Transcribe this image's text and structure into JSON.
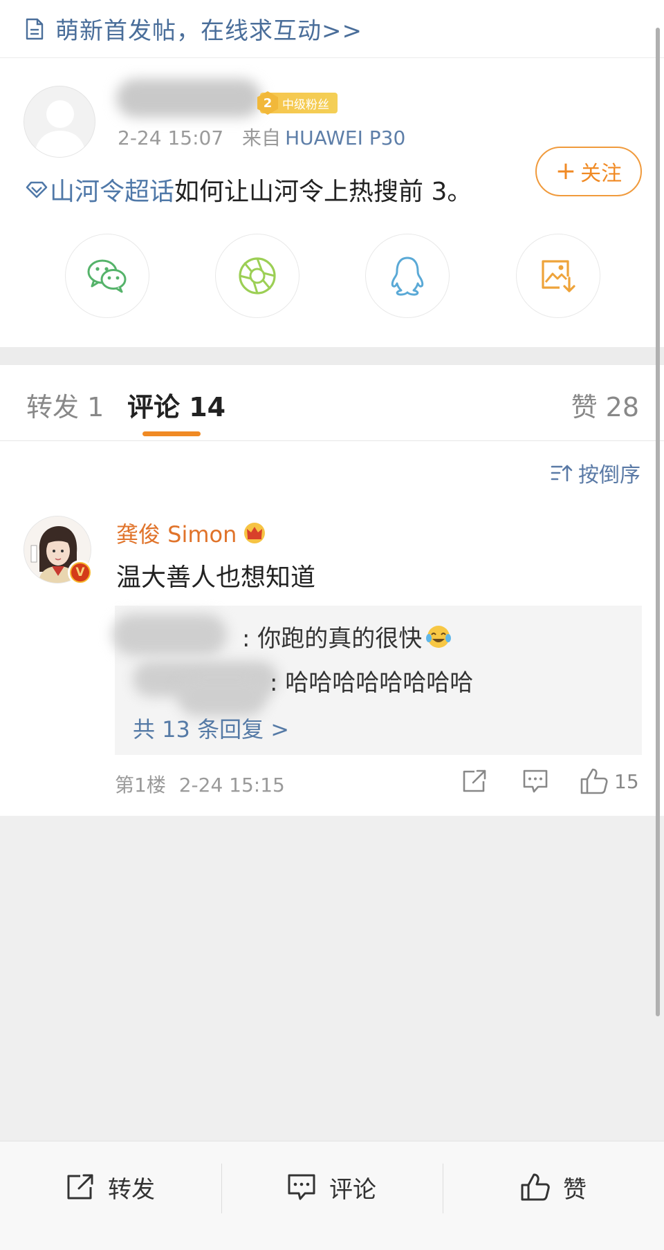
{
  "banner": {
    "text": "萌新首发帖，在线求互动>>",
    "icon": "document-icon"
  },
  "post": {
    "fan_badge": {
      "level": "2",
      "label": "中级粉丝"
    },
    "time": "2-24 15:07",
    "from_label": "来自",
    "device": "HUAWEI P30",
    "follow_label": "关注",
    "follow_plus": "+",
    "topic": "山河令超话",
    "text": "如何让山河令上热搜前 3。",
    "share_icons": [
      "wechat-icon",
      "moments-icon",
      "qq-icon",
      "save-image-icon"
    ]
  },
  "tabs": {
    "repost": "转发 1",
    "comment": "评论 14",
    "like": "赞 28"
  },
  "comments": {
    "sort_label": "按倒序",
    "items": [
      {
        "name": "龚俊 Simon",
        "text": "温大善人也想知道",
        "replies": [
          {
            "text": ": 你跑的真的很快"
          },
          {
            "text": ": 哈哈哈哈哈哈哈哈"
          }
        ],
        "more_replies": "共 13 条回复 >",
        "floor": "第1楼",
        "time": "2-24 15:15",
        "like_count": "15",
        "verified_badge": "V"
      }
    ]
  },
  "bottom_bar": {
    "repost": "转发",
    "comment": "评论",
    "like": "赞"
  },
  "colors": {
    "accent": "#f08a24",
    "link": "#4f78a8",
    "name_orange": "#e0732a"
  }
}
